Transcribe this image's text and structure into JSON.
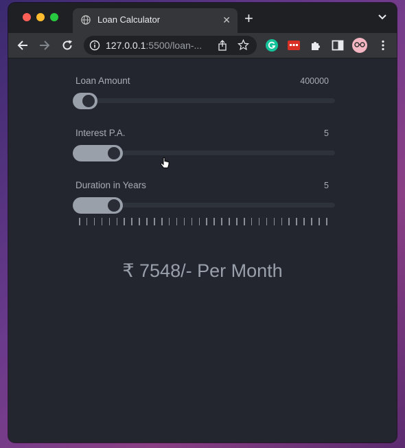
{
  "browser": {
    "tab_title": "Loan Calculator",
    "url_host": "127.0.0.1",
    "url_rest": ":5500/loan-..."
  },
  "sliders": [
    {
      "label": "Loan Amount",
      "value": "400000",
      "fraction": 0.0
    },
    {
      "label": "Interest P.A.",
      "value": "5",
      "fraction": 0.18
    },
    {
      "label": "Duration in Years",
      "value": "5",
      "fraction": 0.18
    }
  ],
  "tick_count": 34,
  "result": "₹ 7548/- Per Month",
  "colors": {
    "background": "#23262f",
    "accent": "#9aa0aa",
    "track": "#2e323b"
  }
}
